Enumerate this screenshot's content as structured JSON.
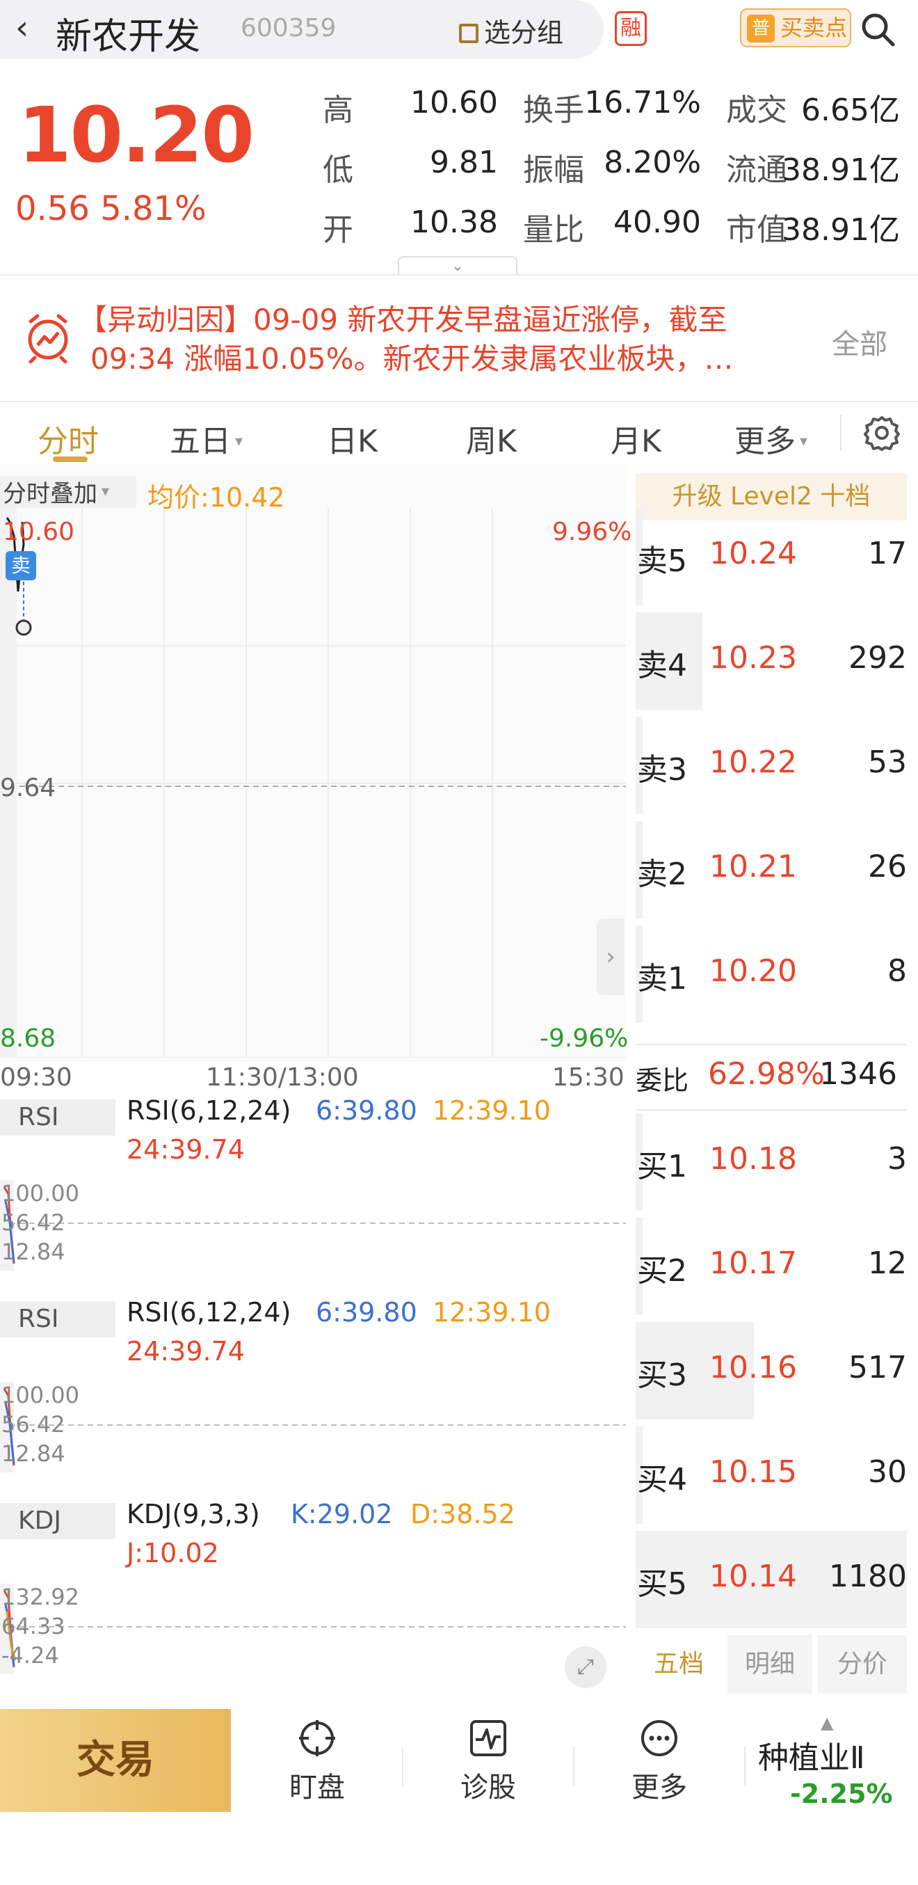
{
  "header": {
    "name": "新农开发",
    "code": "600359",
    "group_label": "选分组",
    "rong_label": "融",
    "buysell_label": "买卖点",
    "buysell_icon_text": "普"
  },
  "quote": {
    "price": "10.20",
    "change": "0.56",
    "change_pct": "5.81%",
    "rows": [
      [
        {
          "k": "高",
          "v": "10.60",
          "red": true
        },
        {
          "k": "换手",
          "v": "16.71%"
        },
        {
          "k": "成交",
          "v": "6.65亿"
        }
      ],
      [
        {
          "k": "低",
          "v": "9.81",
          "red": true
        },
        {
          "k": "振幅",
          "v": "8.20%"
        },
        {
          "k": "流通",
          "v": "38.91亿"
        }
      ],
      [
        {
          "k": "开",
          "v": "10.38",
          "red": true
        },
        {
          "k": "量比",
          "v": "40.90"
        },
        {
          "k": "市值",
          "v": "38.91亿"
        }
      ]
    ]
  },
  "news": {
    "text_line1": "【异动归因】09-09 新农开发早盘逼近涨停，截至",
    "text_line2": "09:34 涨幅10.05%。新农开发隶属农业板块，…",
    "more": "全部"
  },
  "tabs": [
    {
      "label": "分时",
      "active": true
    },
    {
      "label": "五日",
      "caret": true
    },
    {
      "label": "日K"
    },
    {
      "label": "周K"
    },
    {
      "label": "月K"
    },
    {
      "label": "更多",
      "caret": true
    }
  ],
  "chart": {
    "overlay_label": "分时叠加",
    "overlay_caret": "▾",
    "avg_label": "均价:10.42",
    "sell_marker": "卖",
    "y_high": "10.60",
    "y_mid": "9.64",
    "y_low": "8.68",
    "pct_high": "9.96%",
    "pct_low": "-9.96%",
    "time_start": "09:30",
    "time_mid": "11:30/13:00",
    "time_end": "15:30"
  },
  "indicators": [
    {
      "tag": "RSI",
      "name": "RSI(6,12,24)",
      "v1": "6:39.80",
      "v2": "12:39.10",
      "v3": "24:39.74",
      "a1": "100.00",
      "a2": "56.42",
      "a3": "12.84"
    },
    {
      "tag": "RSI",
      "name": "RSI(6,12,24)",
      "v1": "6:39.80",
      "v2": "12:39.10",
      "v3": "24:39.74",
      "a1": "100.00",
      "a2": "56.42",
      "a3": "12.84"
    },
    {
      "tag": "KDJ",
      "name": "KDJ(9,3,3)",
      "v1": "K:29.02",
      "v2": "D:38.52",
      "v3": "J:10.02",
      "a1": "132.92",
      "a2": "64.33",
      "a3": "-4.24"
    }
  ],
  "orderbook": {
    "l2_label": "升级 Level2 十档",
    "sells": [
      {
        "k": "卖5",
        "p": "10.24",
        "v": "17"
      },
      {
        "k": "卖4",
        "p": "10.23",
        "v": "292"
      },
      {
        "k": "卖3",
        "p": "10.22",
        "v": "53"
      },
      {
        "k": "卖2",
        "p": "10.21",
        "v": "26"
      },
      {
        "k": "卖1",
        "p": "10.20",
        "v": "8"
      }
    ],
    "ratio_label": "委比",
    "ratio_pct": "62.98%",
    "ratio_val": "1346",
    "buys": [
      {
        "k": "买1",
        "p": "10.18",
        "v": "3"
      },
      {
        "k": "买2",
        "p": "10.17",
        "v": "12"
      },
      {
        "k": "买3",
        "p": "10.16",
        "v": "517"
      },
      {
        "k": "买4",
        "p": "10.15",
        "v": "30"
      },
      {
        "k": "买5",
        "p": "10.14",
        "v": "1180"
      }
    ],
    "tabs": [
      "五档",
      "明细",
      "分价"
    ]
  },
  "bottom": {
    "trade": "交易",
    "watch": "盯盘",
    "diagnose": "诊股",
    "more": "更多",
    "industry": "种植业Ⅱ",
    "industry_chg": "-2.25%"
  },
  "colors": {
    "up": "#e8452c",
    "down": "#2a9d2a",
    "accent": "#c8962c",
    "avg": "#f39a17",
    "blue": "#3b6fd4"
  }
}
